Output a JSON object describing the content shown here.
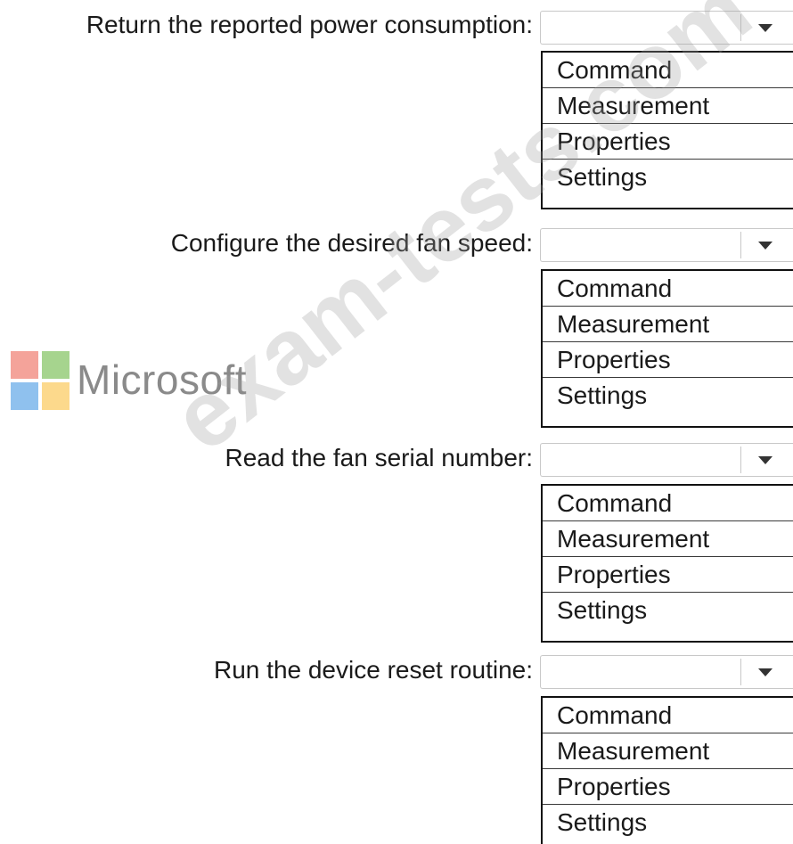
{
  "questions": [
    {
      "label": "Return the reported power consumption:",
      "selected": "",
      "options": [
        "Command",
        "Measurement",
        "Properties",
        "Settings"
      ]
    },
    {
      "label": "Configure the desired fan speed:",
      "selected": "",
      "options": [
        "Command",
        "Measurement",
        "Properties",
        "Settings"
      ]
    },
    {
      "label": "Read the fan serial number:",
      "selected": "",
      "options": [
        "Command",
        "Measurement",
        "Properties",
        "Settings"
      ]
    },
    {
      "label": "Run the device reset routine:",
      "selected": "",
      "options": [
        "Command",
        "Measurement",
        "Properties",
        "Settings"
      ]
    }
  ],
  "logo": {
    "text": "Microsoft",
    "colors": [
      "#f4a39a",
      "#a6d48e",
      "#8fc1ee",
      "#fcd98c"
    ]
  },
  "watermark": {
    "text": "exam-tests.com"
  },
  "icons": {
    "dropdown_arrow": "chevron-down-icon"
  }
}
